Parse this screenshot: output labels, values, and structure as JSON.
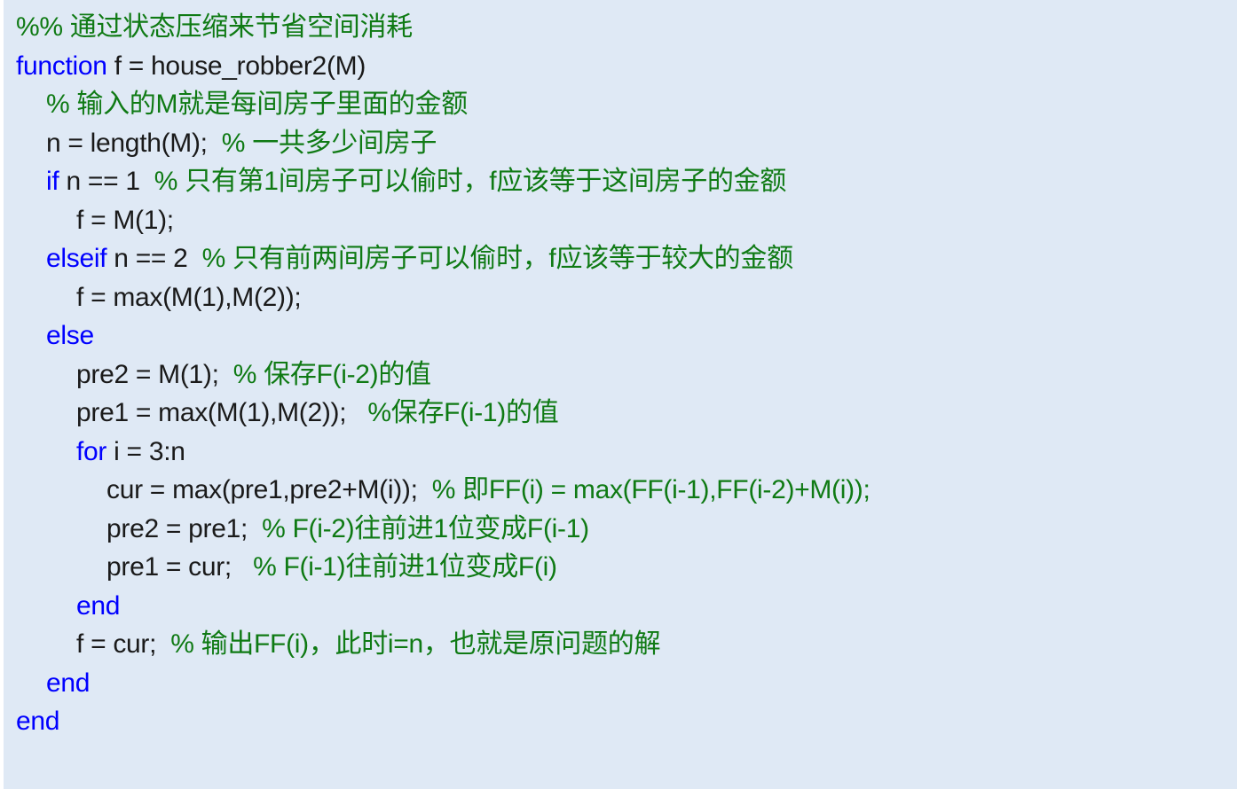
{
  "editor": {
    "language": "MATLAB",
    "background_color": "#dfe9f5",
    "keyword_color": "#0000ff",
    "comment_color": "#0f7a14",
    "text_color": "#1a1a1a",
    "function_name": "house_robber2",
    "line_count": 18
  },
  "code": {
    "lines": [
      {
        "indent": 0,
        "tokens": [
          {
            "type": "comment",
            "text": "%% 通过状态压缩来节省空间消耗"
          }
        ]
      },
      {
        "indent": 0,
        "tokens": [
          {
            "type": "kw",
            "text": "function"
          },
          {
            "type": "plain",
            "text": " f = house_robber2(M)"
          }
        ]
      },
      {
        "indent": 1,
        "tokens": [
          {
            "type": "comment",
            "text": "% 输入的M就是每间房子里面的金额"
          }
        ]
      },
      {
        "indent": 1,
        "tokens": [
          {
            "type": "plain",
            "text": "n = length(M);  "
          },
          {
            "type": "comment",
            "text": "% 一共多少间房子"
          }
        ]
      },
      {
        "indent": 1,
        "tokens": [
          {
            "type": "kw",
            "text": "if"
          },
          {
            "type": "plain",
            "text": " n == 1  "
          },
          {
            "type": "comment",
            "text": "% 只有第1间房子可以偷时，f应该等于这间房子的金额"
          }
        ]
      },
      {
        "indent": 2,
        "tokens": [
          {
            "type": "plain",
            "text": "f = M(1);"
          }
        ]
      },
      {
        "indent": 1,
        "tokens": [
          {
            "type": "kw",
            "text": "elseif"
          },
          {
            "type": "plain",
            "text": " n == 2  "
          },
          {
            "type": "comment",
            "text": "% 只有前两间房子可以偷时，f应该等于较大的金额"
          }
        ]
      },
      {
        "indent": 2,
        "tokens": [
          {
            "type": "plain",
            "text": "f = max(M(1),M(2));"
          }
        ]
      },
      {
        "indent": 1,
        "tokens": [
          {
            "type": "kw",
            "text": "else"
          }
        ]
      },
      {
        "indent": 2,
        "tokens": [
          {
            "type": "plain",
            "text": "pre2 = M(1);  "
          },
          {
            "type": "comment",
            "text": "% 保存F(i-2)的值"
          }
        ]
      },
      {
        "indent": 2,
        "tokens": [
          {
            "type": "plain",
            "text": "pre1 = max(M(1),M(2));   "
          },
          {
            "type": "comment",
            "text": "%保存F(i-1)的值"
          }
        ]
      },
      {
        "indent": 2,
        "tokens": [
          {
            "type": "kw",
            "text": "for"
          },
          {
            "type": "plain",
            "text": " i = 3:n"
          }
        ]
      },
      {
        "indent": 3,
        "tokens": [
          {
            "type": "plain",
            "text": "cur = max(pre1,pre2+M(i));  "
          },
          {
            "type": "comment",
            "text": "% 即FF(i) = max(FF(i-1),FF(i-2)+M(i));"
          }
        ]
      },
      {
        "indent": 3,
        "tokens": [
          {
            "type": "plain",
            "text": "pre2 = pre1;  "
          },
          {
            "type": "comment",
            "text": "% F(i-2)往前进1位变成F(i-1)"
          }
        ]
      },
      {
        "indent": 3,
        "tokens": [
          {
            "type": "plain",
            "text": "pre1 = cur;   "
          },
          {
            "type": "comment",
            "text": "% F(i-1)往前进1位变成F(i)"
          }
        ]
      },
      {
        "indent": 2,
        "tokens": [
          {
            "type": "kw",
            "text": "end"
          }
        ]
      },
      {
        "indent": 2,
        "tokens": [
          {
            "type": "plain",
            "text": "f = cur;  "
          },
          {
            "type": "comment",
            "text": "% 输出FF(i)，此时i=n，也就是原问题的解"
          }
        ]
      },
      {
        "indent": 1,
        "tokens": [
          {
            "type": "kw",
            "text": "end"
          }
        ]
      },
      {
        "indent": 0,
        "tokens": [
          {
            "type": "kw",
            "text": "end"
          }
        ]
      }
    ]
  }
}
